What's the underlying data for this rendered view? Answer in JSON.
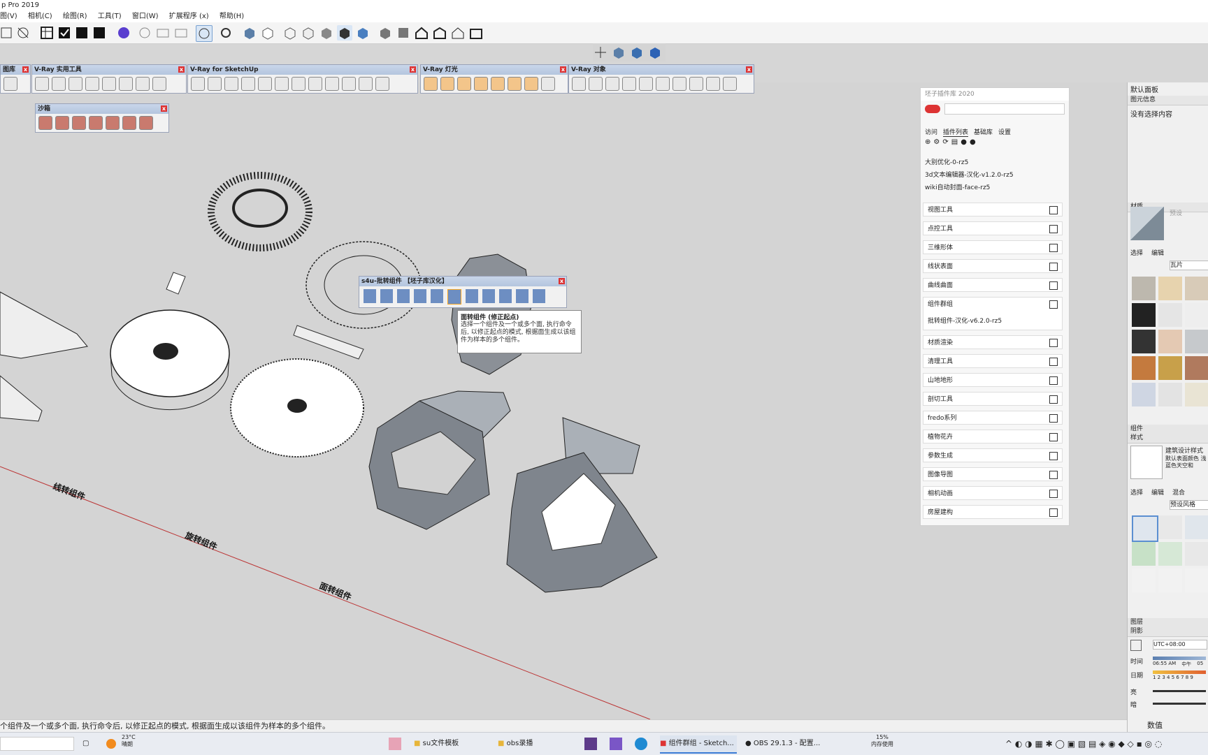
{
  "app": {
    "title": "p Pro 2019"
  },
  "menu": [
    "图(V)",
    "相机(C)",
    "绘图(R)",
    "工具(T)",
    "窗口(W)",
    "扩展程序 (x)",
    "帮助(H)"
  ],
  "toolbars": {
    "trayleft": "图库",
    "vray_util": "V-Ray 实用工具",
    "vray_su": "V-Ray for SketchUp",
    "vray_light": "V-Ray 灯光",
    "vray_obj": "V-Ray 对象",
    "sandbox": "沙箱",
    "context": "s4u-批转组件 【坯子库汉化】"
  },
  "tooltip": {
    "title": "面转组件 (修正起点)",
    "body": "选择一个组件及一个或多个面, 执行命令后, 以修正起点的模式, 根据面生成以该组件为样本的多个组件。"
  },
  "scene_labels": {
    "line_conv": "线转组件",
    "rotate_conv": "旋转组件",
    "face_conv": "面转组件"
  },
  "plugin_panel": {
    "title": "坯子插件库 2020",
    "tabs": [
      "访问",
      "插件列表",
      "基础库",
      "设置"
    ],
    "plugin_items": [
      "大别优化-0-rz5",
      "3d文本编辑器-汉化-v1.2.0-rz5",
      "wiki自动封面-face-rz5"
    ],
    "categories": [
      "视图工具",
      "点控工具",
      "三维形体",
      "线状表面",
      "曲线曲面",
      "组件群组",
      "材质渲染",
      "清理工具",
      "山地地形",
      "剖切工具",
      "fredo系列",
      "植物花卉",
      "参数生成",
      "图像导图",
      "相机动画",
      "房屋建构"
    ],
    "group_item": "批转组件-汉化-v6.2.0-rz5"
  },
  "right_tray": {
    "default_panel": "默认面板",
    "entity_info": "图元信息",
    "no_selection": "没有选择内容",
    "materials": "材质",
    "preview": "预设",
    "select": "选择",
    "edit": "编辑",
    "mix": "混合",
    "tiles": "瓦片",
    "components": "组件",
    "styles": "样式",
    "style_name": "建筑设计样式",
    "style_desc": "默认表面颜色 浅蓝色天空和",
    "preset_style": "预设风格",
    "layers": "图层",
    "shadows": "阴影",
    "utc": "UTC+08:00",
    "time": "时间",
    "time_vals": [
      "06:55 AM",
      "中午",
      "05"
    ],
    "date": "日期",
    "date_vals": "1 2 3 4 5 6 7 8 9",
    "light": "亮",
    "dark": "暗",
    "value_label": "数值"
  },
  "status": {
    "text": "个组件及一个或多个面, 执行命令后, 以修正起点的模式, 根据面生成以该组件为样本的多个组件。"
  },
  "taskbar": {
    "weather_temp": "23°C",
    "weather_desc": "晴朗",
    "apps": [
      "su文件模板",
      "obs录播",
      "组件群组 - Sketch...",
      "OBS 29.1.3 - 配置..."
    ],
    "memory_pct": "15%",
    "memory_label": "内存使用"
  },
  "colors": {
    "vray_cap": "#c2d2e8",
    "swatch_wood": "#c47a3e",
    "close_red": "#d33"
  }
}
